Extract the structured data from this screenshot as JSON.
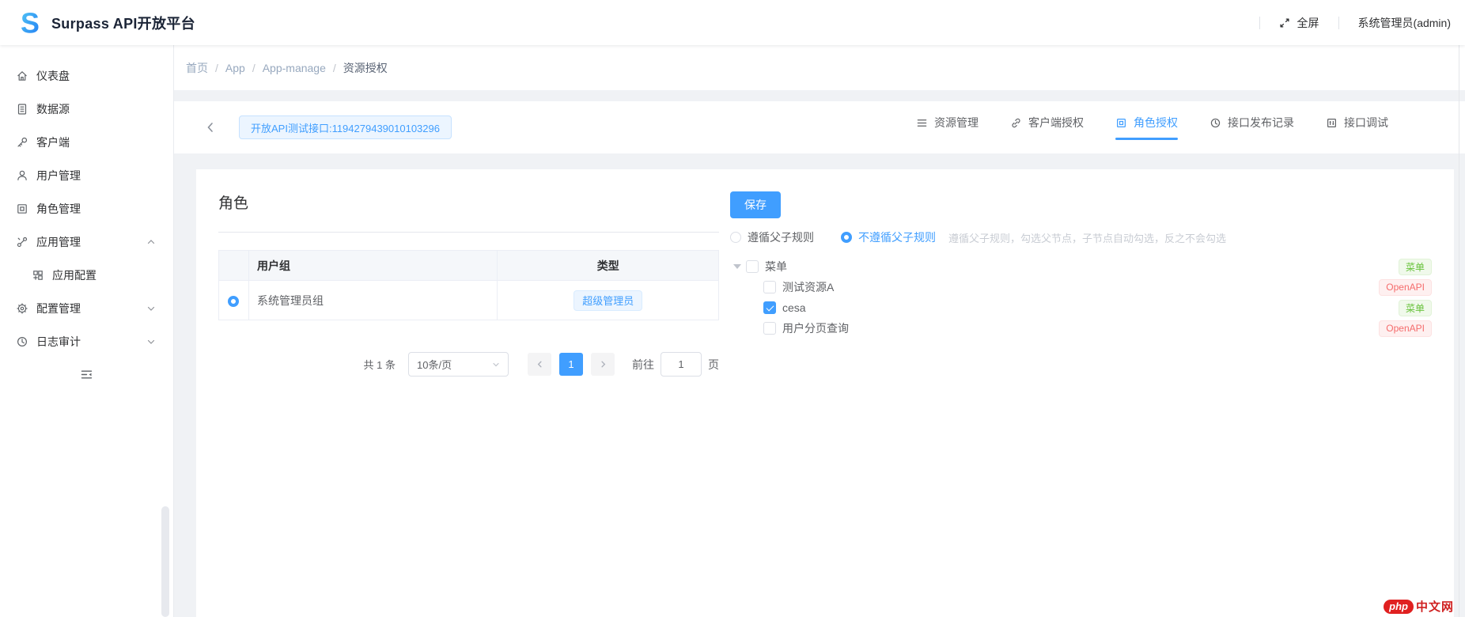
{
  "header": {
    "title": "Surpass API开放平台",
    "logo_letter": "S",
    "fullscreen_label": "全屏",
    "user_label": "系统管理员(admin)"
  },
  "sidebar": {
    "items": [
      {
        "label": "仪表盘"
      },
      {
        "label": "数据源"
      },
      {
        "label": "客户端"
      },
      {
        "label": "用户管理"
      },
      {
        "label": "角色管理"
      },
      {
        "label": "应用管理"
      },
      {
        "label": "应用配置"
      },
      {
        "label": "配置管理"
      },
      {
        "label": "日志审计"
      }
    ]
  },
  "breadcrumb": {
    "separator": "/",
    "items": [
      "首页",
      "App",
      "App-manage",
      "资源授权"
    ]
  },
  "toolbar": {
    "entity_tag": "开放API测试接口:1194279439010103296",
    "tabs": [
      {
        "label": "资源管理"
      },
      {
        "label": "客户端授权"
      },
      {
        "label": "角色授权"
      },
      {
        "label": "接口发布记录"
      },
      {
        "label": "接口调试"
      }
    ]
  },
  "role_panel": {
    "title": "角色",
    "columns": {
      "group": "用户组",
      "type": "类型"
    },
    "row": {
      "group": "系统管理员组",
      "type_tag": "超级管理员"
    },
    "pagination": {
      "total_label": "共 1 条",
      "page_size": "10条/页",
      "current_page": "1",
      "goto_label": "前往",
      "goto_value": "1",
      "page_unit": "页"
    }
  },
  "auth_panel": {
    "save_label": "保存",
    "radio_follow": "遵循父子规则",
    "radio_not_follow": "不遵循父子规则",
    "hint": "遵循父子规则，勾选父节点，子节点自动勾选，反之不会勾选",
    "tree": [
      {
        "label": "菜单",
        "tag": "菜单"
      },
      {
        "label": "测试资源A",
        "tag": "OpenAPI"
      },
      {
        "label": "cesa",
        "tag": "菜单"
      },
      {
        "label": "用户分页查询",
        "tag": "OpenAPI"
      }
    ]
  },
  "watermark": {
    "badge": "php",
    "text": "中文网"
  },
  "colors": {
    "primary": "#409eff",
    "success": "#67c23a",
    "danger": "#f56c6c"
  }
}
